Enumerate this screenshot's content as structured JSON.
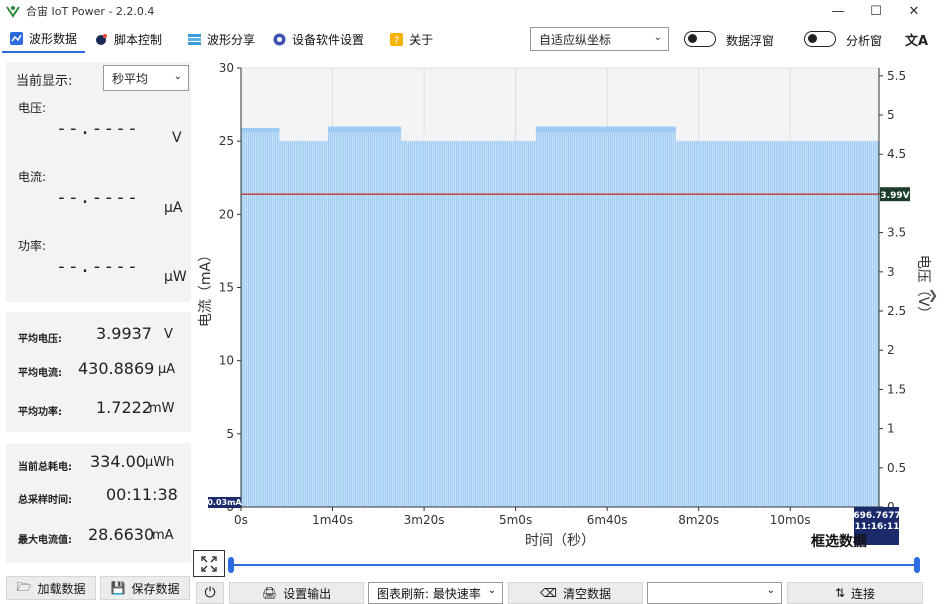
{
  "window": {
    "title": "合宙 IoT Power - 2.2.0.4",
    "minimize": "—",
    "maximize": "☐",
    "close": "✕"
  },
  "tabs": [
    {
      "label": "波形数据",
      "icon": "waveform-icon"
    },
    {
      "label": "脚本控制",
      "icon": "script-icon"
    },
    {
      "label": "波形分享",
      "icon": "share-icon"
    },
    {
      "label": "设备软件设置",
      "icon": "settings-icon"
    },
    {
      "label": "关于",
      "icon": "about-icon"
    }
  ],
  "toolbar": {
    "axis_mode": "自适应纵坐标",
    "float_window_label": "数据浮窗",
    "analysis_window_label": "分析窗",
    "translate": "文A"
  },
  "left_panel": {
    "current_display_label": "当前显示:",
    "current_display_value": "秒平均",
    "voltage_label": "电压:",
    "voltage_value": "--.----",
    "voltage_unit": "V",
    "current_label": "电流:",
    "current_value": "--.----",
    "current_unit": "μA",
    "power_label": "功率:",
    "power_value": "--.----",
    "power_unit": "μW"
  },
  "averages": {
    "avg_voltage_label": "平均电压:",
    "avg_voltage_value": "3.9937",
    "avg_voltage_unit": "V",
    "avg_current_label": "平均电流:",
    "avg_current_value": "430.8869",
    "avg_current_unit": "μA",
    "avg_power_label": "平均功率:",
    "avg_power_value": "1.7222",
    "avg_power_unit": "mW"
  },
  "totals": {
    "energy_label": "当前总耗电:",
    "energy_value": "334.00",
    "energy_unit": "μWh",
    "duration_label": "总采样时间:",
    "duration_value": "00:11:38",
    "max_current_label": "最大电流值:",
    "max_current_value": "28.6630",
    "max_current_unit": "mA"
  },
  "bottom_bar": {
    "load_data": "加载数据",
    "save_data": "保存数据",
    "power_icon": "⏻",
    "set_output": "设置输出",
    "refresh_label": "图表刷新: 最快速率",
    "clear_data": "清空数据",
    "port_select": "",
    "connect": "连接"
  },
  "chart_data": {
    "type": "area",
    "xlabel": "时间（秒）",
    "ylabel": "电流（mA）",
    "y2label": "电压（V）",
    "x_tick_labels": [
      "0s",
      "1m40s",
      "3m20s",
      "5m0s",
      "6m40s",
      "8m20s",
      "10m0s"
    ],
    "x_ticks": [
      0,
      100,
      200,
      300,
      400,
      500,
      600
    ],
    "xlim": [
      0,
      697
    ],
    "ylim": [
      0,
      30
    ],
    "y_ticks": [
      0,
      5,
      10,
      15,
      20,
      25,
      30
    ],
    "y2lim": [
      0,
      5.6
    ],
    "y2_ticks": [
      0,
      0.5,
      1,
      1.5,
      2,
      2.5,
      3,
      3.5,
      4,
      4.5,
      5,
      5.5
    ],
    "series": [
      {
        "name": "电流",
        "color": "#9ecbf2",
        "segments": [
          {
            "x0": 0,
            "x1": 42,
            "level": 25.9
          },
          {
            "x0": 42,
            "x1": 95,
            "level": 25.0
          },
          {
            "x0": 95,
            "x1": 175,
            "level": 26.0
          },
          {
            "x0": 175,
            "x1": 240,
            "level": 25.0
          },
          {
            "x0": 240,
            "x1": 322,
            "level": 25.0
          },
          {
            "x0": 322,
            "x1": 475,
            "level": 26.0
          },
          {
            "x0": 475,
            "x1": 575,
            "level": 25.0
          },
          {
            "x0": 575,
            "x1": 697,
            "level": 25.0
          }
        ]
      },
      {
        "name": "电压",
        "color": "#c0392b",
        "value": 3.99
      }
    ],
    "voltage_marker": "3.99V",
    "min_current_marker": "0.03mA",
    "cursor_value": "696.7677",
    "cursor_time": "11:16:11",
    "box_select_label": "框选数据"
  }
}
